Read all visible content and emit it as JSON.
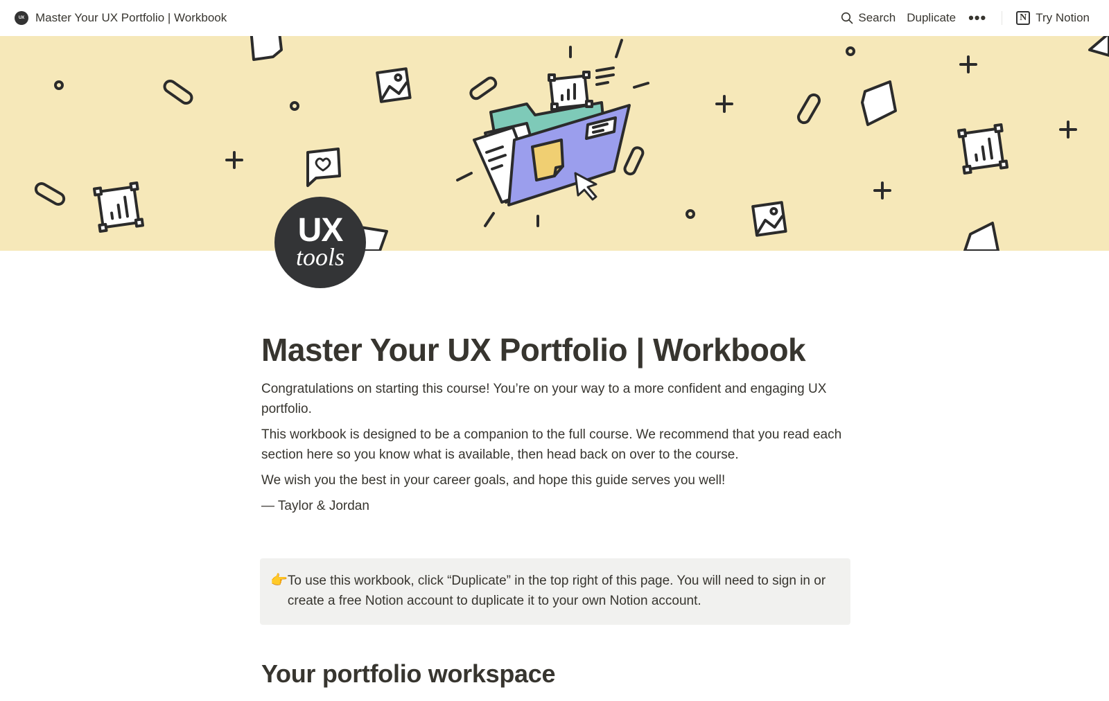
{
  "topbar": {
    "page_icon_text": "UX",
    "title": "Master Your UX Portfolio | Workbook",
    "search_label": "Search",
    "duplicate_label": "Duplicate",
    "more_label": "•••",
    "try_notion_label": "Try Notion",
    "notion_logo_glyph": "N"
  },
  "cover": {
    "description": "Illustration of an open folder with documents, charts, paperclips and sparkles",
    "background_color": "#f6e8b9",
    "folder_color": "#9b9eed",
    "tab_color": "#7ecab8",
    "note_color": "#f0cf72"
  },
  "avatar": {
    "line1": "UX",
    "line2": "tools"
  },
  "page": {
    "title": "Master Your UX Portfolio | Workbook",
    "paragraphs": [
      "Congratulations on starting this course! You’re on your way to a more confident and engaging UX portfolio.",
      "This workbook is designed to be a companion to the full course. We recommend that you read each section here so you know what is available, then head back on over to the course.",
      "We wish you the best in your career goals, and hope this guide serves you well!",
      "— Taylor & Jordan"
    ],
    "callout": {
      "emoji": "👉",
      "text": "To use this workbook, click “Duplicate” in the top right of this page. You will need to sign in or create a free Notion account to duplicate it to your own Notion account."
    },
    "section_heading": "Your portfolio workspace"
  }
}
